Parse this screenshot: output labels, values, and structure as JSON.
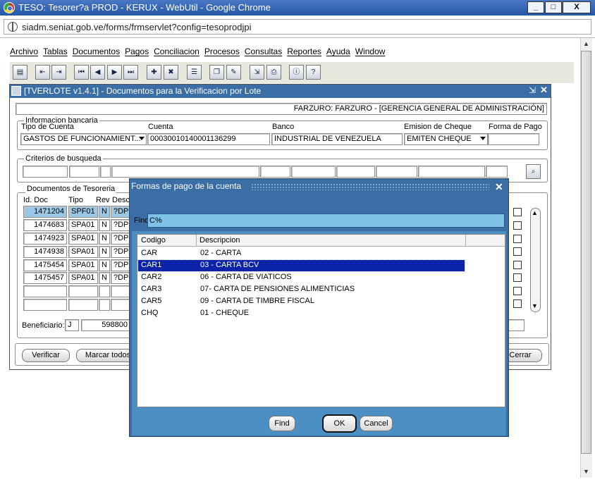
{
  "browser": {
    "title": "TESO: Tesorer?a PROD - KERUX - WebUtil - Google Chrome",
    "url": "siadm.seniat.gob.ve/forms/frmservlet?config=tesoprodjpi",
    "minimize": "_",
    "maximize": "□",
    "close": "X"
  },
  "menu": [
    "Archivo",
    "Tablas",
    "Documentos",
    "Pagos",
    "Conciliacion",
    "Procesos",
    "Consultas",
    "Reportes",
    "Ayuda",
    "Window"
  ],
  "toolbar": [
    "save-icon",
    "enter-query-icon",
    "execute-query-icon",
    "first-record-icon",
    "prev-record-icon",
    "next-record-icon",
    "last-record-icon",
    "insert-record-icon",
    "delete-record-icon",
    "lov-icon",
    "copy-icon",
    "edit-icon",
    "exit-icon",
    "print-icon",
    "info-icon",
    "help-icon"
  ],
  "form": {
    "title": "[TVERLOTE v1.4.1] - Documentos para la Verificacion por Lote",
    "user_line": "FARZURO: FARZURO -  [GERENCIA GENERAL DE ADMINISTRACIÓN]",
    "bank_group": "Informacion bancaria",
    "tipo_cuenta_label": "Tipo de Cuenta",
    "tipo_cuenta": "GASTOS DE FUNCIONAMIENT...",
    "cuenta_label": "Cuenta",
    "cuenta": "00030010140001136299",
    "banco_label": "Banco",
    "banco": "INDUSTRIAL DE VENEZUELA",
    "emision_label": "Emision de Cheque",
    "emision": "EMITEN CHEQUE",
    "forma_label": "Forma de Pago",
    "forma": "",
    "criterios_label": "Criterios de busqueda",
    "docs_group": "Documentos de Tesoreria",
    "col_id": "Id. Doc",
    "col_tipo": "Tipo",
    "col_rev": "Rev",
    "col_desc": "Desc",
    "docs": [
      {
        "id": "1471204",
        "tipo": "SPF01",
        "rev": "N",
        "desc": "?DP S"
      },
      {
        "id": "1474683",
        "tipo": "SPA01",
        "rev": "N",
        "desc": "?DP S"
      },
      {
        "id": "1474923",
        "tipo": "SPA01",
        "rev": "N",
        "desc": "?DP S"
      },
      {
        "id": "1474938",
        "tipo": "SPA01",
        "rev": "N",
        "desc": "?DP S"
      },
      {
        "id": "1475454",
        "tipo": "SPA01",
        "rev": "N",
        "desc": "?DP S"
      },
      {
        "id": "1475457",
        "tipo": "SPA01",
        "rev": "N",
        "desc": "?DP S"
      }
    ],
    "beneficiario_label": "Beneficiario:",
    "benef_tipo": "J",
    "benef_num": "598800",
    "verificar": "Verificar",
    "marcar": "Marcar todos",
    "cerrar": "Cerrar"
  },
  "dialog": {
    "title": "Formas de pago de la cuenta",
    "find_label": "Find",
    "find_value": "C%",
    "col_codigo": "Codigo",
    "col_desc": "Descripcion",
    "rows": [
      {
        "codigo": "CAR",
        "desc": "02 - CARTA"
      },
      {
        "codigo": "CAR1",
        "desc": "03 - CARTA BCV"
      },
      {
        "codigo": "CAR2",
        "desc": "06 - CARTA DE VIATICOS"
      },
      {
        "codigo": "CAR3",
        "desc": "07- CARTA DE PENSIONES ALIMENTICIAS"
      },
      {
        "codigo": "CAR5",
        "desc": "09 - CARTA DE TIMBRE FISCAL"
      },
      {
        "codigo": "CHQ",
        "desc": "01 - CHEQUE"
      }
    ],
    "find_btn": "Find",
    "ok_btn": "OK",
    "cancel_btn": "Cancel"
  }
}
